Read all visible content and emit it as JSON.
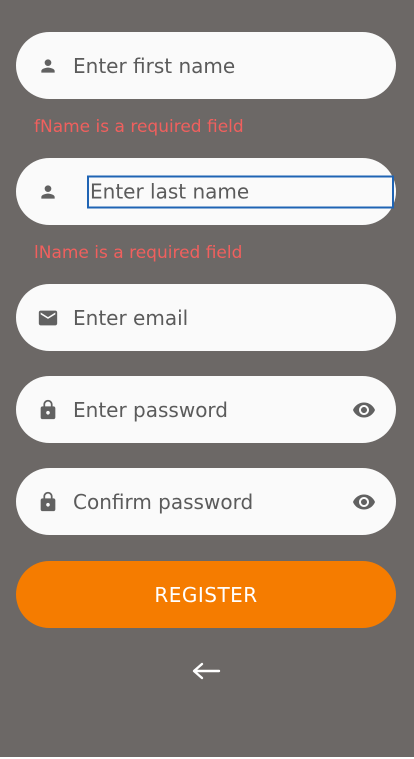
{
  "form": {
    "first_name": {
      "placeholder": "Enter first name",
      "value": "",
      "icon": "person-icon",
      "error": "fName is a required field"
    },
    "last_name": {
      "placeholder": "Enter last name",
      "value": "",
      "icon": "person-icon",
      "error": "lName is a required field"
    },
    "email": {
      "placeholder": "Enter email",
      "value": "",
      "icon": "mail-icon"
    },
    "password": {
      "placeholder": "Enter password",
      "value": "",
      "icon": "lock-icon",
      "toggle_icon": "eye-icon"
    },
    "confirm_password": {
      "placeholder": "Confirm password",
      "value": "",
      "icon": "lock-icon",
      "toggle_icon": "eye-icon"
    }
  },
  "actions": {
    "register_label": "REGISTER",
    "back_icon": "arrow-left-icon"
  },
  "colors": {
    "background": "#6c6866",
    "field_background": "#fafafa",
    "error_text": "#f0605e",
    "primary_button": "#f57c00",
    "focus_border": "#1f64b4"
  }
}
